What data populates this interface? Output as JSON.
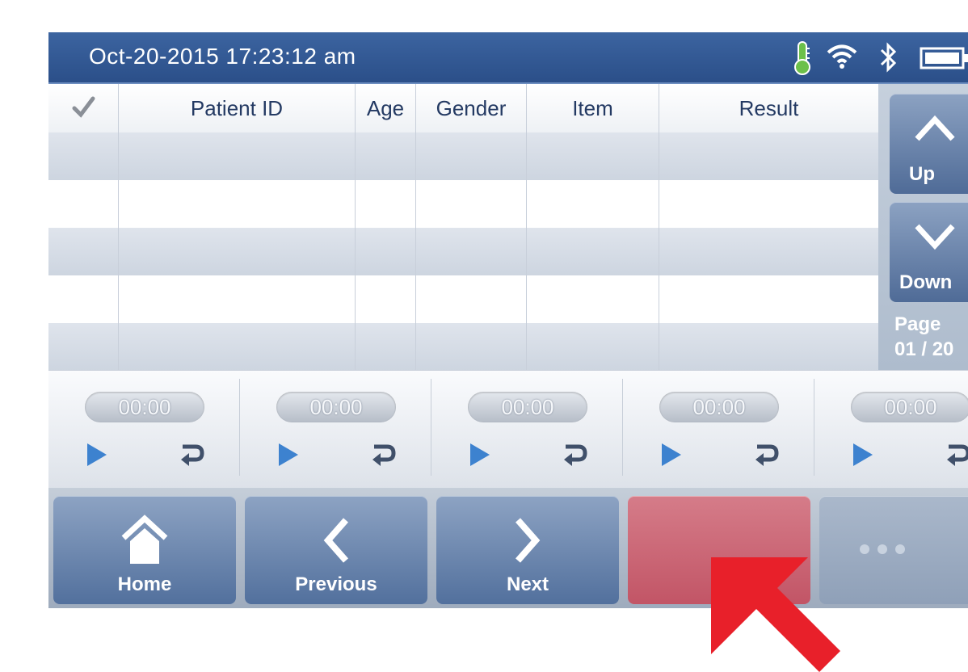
{
  "status_bar": {
    "datetime": "Oct-20-2015  17:23:12 am",
    "icons": [
      "thermometer-icon",
      "wifi-icon",
      "bluetooth-icon",
      "battery-icon"
    ]
  },
  "table": {
    "headers": [
      "✓",
      "Patient ID",
      "Age",
      "Gender",
      "Item",
      "Result"
    ],
    "rows": [
      [
        "",
        "",
        "",
        "",
        "",
        ""
      ],
      [
        "",
        "",
        "",
        "",
        "",
        ""
      ],
      [
        "",
        "",
        "",
        "",
        "",
        ""
      ],
      [
        "",
        "",
        "",
        "",
        "",
        ""
      ],
      [
        "",
        "",
        "",
        "",
        "",
        ""
      ]
    ]
  },
  "side_panel": {
    "up_label": "Up",
    "down_label": "Down",
    "page_label": "Page",
    "page_value": "01 / 20"
  },
  "timers": [
    {
      "value": "00:00"
    },
    {
      "value": "00:00"
    },
    {
      "value": "00:00"
    },
    {
      "value": "00:00"
    },
    {
      "value": "00:00"
    }
  ],
  "nav": {
    "home_label": "Home",
    "previous_label": "Previous",
    "next_label": "Next",
    "red_button_color": "#c86070",
    "more_icon": "ellipsis-icon"
  },
  "colors": {
    "status_bar": "#2f5590",
    "button_blue": "#6d86ad",
    "accent_red": "#e8202a"
  }
}
